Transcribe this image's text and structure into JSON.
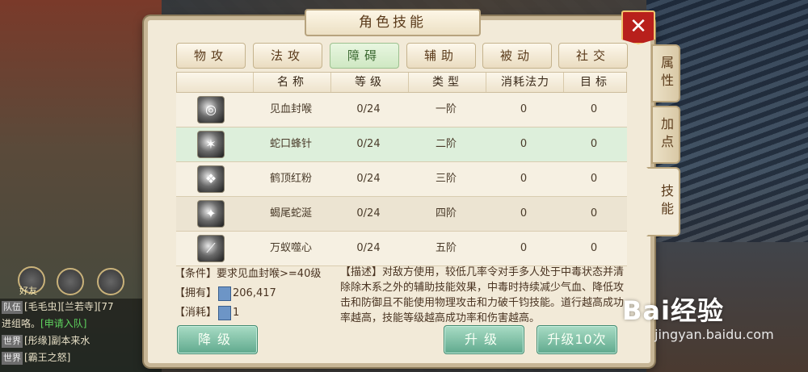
{
  "dialog": {
    "title": "角色技能",
    "close_label": "✕"
  },
  "tabs": [
    {
      "label": "物攻",
      "active": false
    },
    {
      "label": "法攻",
      "active": false
    },
    {
      "label": "障碍",
      "active": true
    },
    {
      "label": "辅助",
      "active": false
    },
    {
      "label": "被动",
      "active": false
    },
    {
      "label": "社交",
      "active": false
    }
  ],
  "table": {
    "headers": [
      "",
      "名称",
      "等级",
      "类型",
      "消耗法力",
      "目标"
    ],
    "rows": [
      {
        "name": "见血封喉",
        "level": "0/24",
        "type": "一阶",
        "mana": "0",
        "target": "0"
      },
      {
        "name": "蛇口蜂针",
        "level": "0/24",
        "type": "二阶",
        "mana": "0",
        "target": "0"
      },
      {
        "name": "鹤顶红粉",
        "level": "0/24",
        "type": "三阶",
        "mana": "0",
        "target": "0"
      },
      {
        "name": "蝎尾蛇涎",
        "level": "0/24",
        "type": "四阶",
        "mana": "0",
        "target": "0"
      },
      {
        "name": "万蚁噬心",
        "level": "0/24",
        "type": "五阶",
        "mana": "0",
        "target": "0"
      }
    ],
    "selected_index": 1
  },
  "info": {
    "condition_label": "【条件】",
    "condition_text": "要求见血封喉>=40级",
    "owned_label": "【拥有】",
    "owned_value": "206,417",
    "cost_label": "【消耗】",
    "cost_value": "1",
    "desc_label": "【描述】",
    "desc_text": "对敌方使用，较低几率令对手多人处于中毒状态并清除除木系之外的辅助技能效果，中毒时持续减少气血、降低攻击和防御且不能使用物理攻击和力破千钧技能。道行越高成功率越高，技能等级越高成功率和伤害越高。"
  },
  "buttons": {
    "downgrade": "降级",
    "upgrade": "升级",
    "upgrade10": "升级10次"
  },
  "side_tabs": [
    "属性",
    "加点",
    "技能"
  ],
  "chat": {
    "lines": [
      {
        "channel": "队伍",
        "text": "[毛毛虫][兰若寺][77",
        "extra": ""
      },
      {
        "channel": "",
        "text": "进组咯。",
        "extra": "[申请入队]"
      },
      {
        "channel": "世界",
        "text": "[彤缘]副本来水",
        "extra": ""
      },
      {
        "channel": "世界",
        "text": "[霸王之怒]",
        "extra": ""
      }
    ],
    "friend_label": "好友"
  },
  "watermark": {
    "logo": "Bai经验",
    "url": "jingyan.baidu.com"
  }
}
